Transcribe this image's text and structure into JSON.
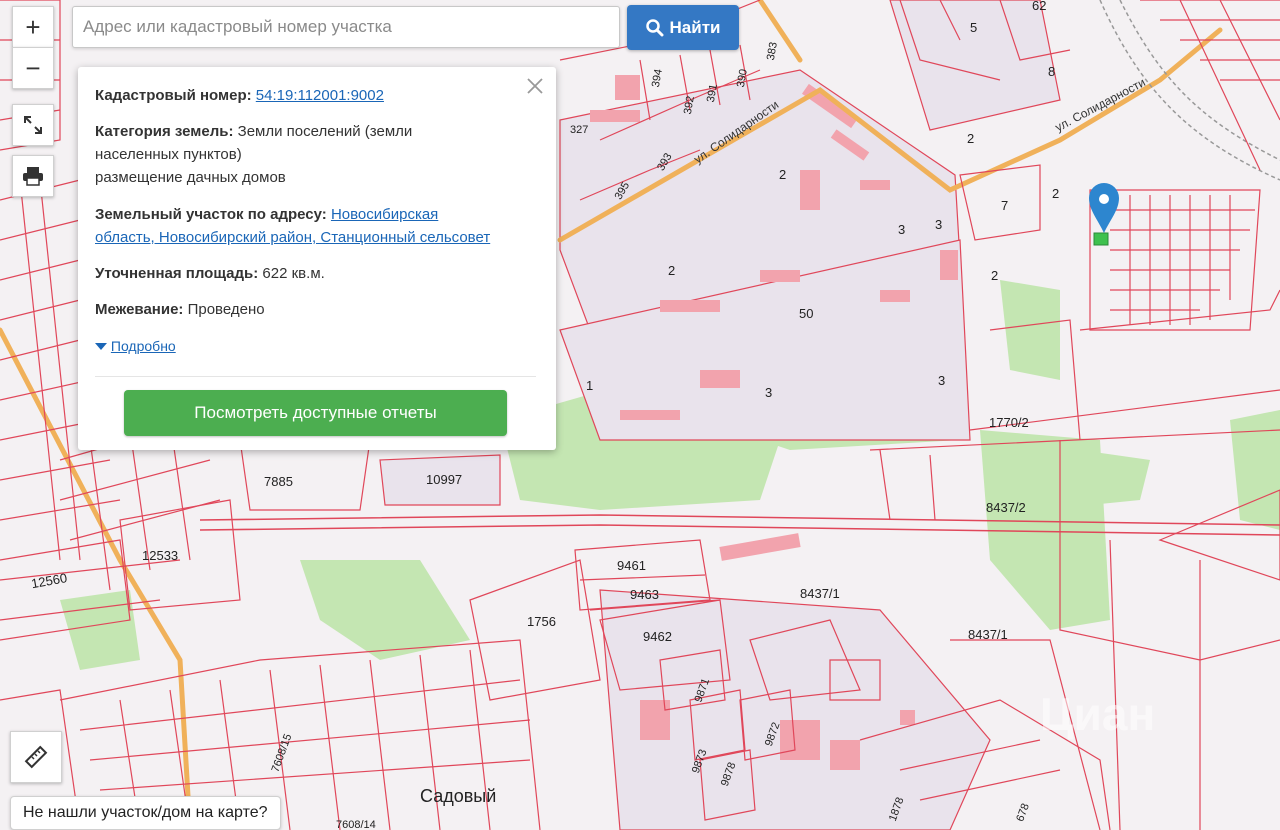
{
  "search": {
    "placeholder": "Адрес или кадастровый номер участка",
    "button_label": "Найти"
  },
  "controls": {
    "zoom_in": "+",
    "zoom_out": "−"
  },
  "popup": {
    "cadastral_label": "Кадастровый номер:",
    "cadastral_value": "54:19:112001:9002",
    "category_label": "Категория земель:",
    "category_value_1": "Земли поселений (земли",
    "category_value_2": "населенных пунктов)",
    "category_value_3": "размещение дачных домов",
    "address_label": "Земельный участок по адресу:",
    "address_value_1": "Новосибирская",
    "address_value_2": "область, Новосибирский район, Станционный сельсовет",
    "area_label": "Уточненная площадь:",
    "area_value": "622 кв.м.",
    "survey_label": "Межевание:",
    "survey_value": "Проведено",
    "details_link": "Подробно",
    "report_button": "Посмотреть доступные отчеты"
  },
  "bottom": {
    "not_found_label": "Не нашли участок/дом на карте?"
  },
  "map": {
    "parcel_labels": [
      "327",
      "394",
      "391",
      "390",
      "383",
      "392",
      "393",
      "395",
      "5",
      "62",
      "8",
      "2",
      "2",
      "2",
      "7",
      "2",
      "3",
      "3",
      "2",
      "50",
      "1",
      "3",
      "3",
      "1770/2",
      "10997",
      "7885",
      "12533",
      "12560",
      "8437/2",
      "9461",
      "9463",
      "1756",
      "9462",
      "8437/1",
      "8437/1",
      "9871",
      "9872",
      "9873",
      "9878",
      "1878",
      "7608/15",
      "7608/14",
      "678"
    ],
    "street_labels": [
      "ул. Солидарности",
      "ул. Солидарности",
      "Садовый"
    ],
    "watermark": "Циан",
    "colors": {
      "parcel_line": "#e0475a",
      "road": "#f0b15a",
      "green": "#bfe3ad",
      "built": "#f2a9b2",
      "selected": "#3ec14e",
      "marker": "#2d86cf"
    }
  }
}
